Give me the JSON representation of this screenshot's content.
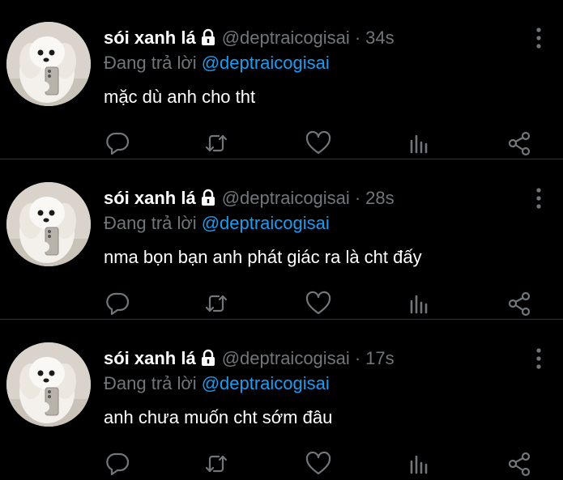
{
  "tweets": [
    {
      "name": "sói xanh lá",
      "handle": "@deptraicogisai",
      "time": "34s",
      "reply_prefix": "Đang trả lời",
      "reply_to": "@deptraicogisai",
      "text": "mặc dù anh cho tht"
    },
    {
      "name": "sói xanh lá",
      "handle": "@deptraicogisai",
      "time": "28s",
      "reply_prefix": "Đang trả lời",
      "reply_to": "@deptraicogisai",
      "text": "nma bọn bạn anh phát giác ra là cht đấy"
    },
    {
      "name": "sói xanh lá",
      "handle": "@deptraicogisai",
      "time": "17s",
      "reply_prefix": "Đang trả lời",
      "reply_to": "@deptraicogisai",
      "text": "anh chưa muốn cht sớm đâu"
    }
  ],
  "separator": "·",
  "icons": {
    "lock": "lock-icon",
    "more": "more-vertical-icon",
    "reply": "reply-icon",
    "retweet": "retweet-icon",
    "like": "heart-icon",
    "stats": "stats-icon",
    "share": "share-icon"
  },
  "colors": {
    "background": "#000000",
    "text": "#ffffff",
    "muted": "#71767b",
    "link": "#1d9bf0",
    "divider": "#2f3336"
  }
}
